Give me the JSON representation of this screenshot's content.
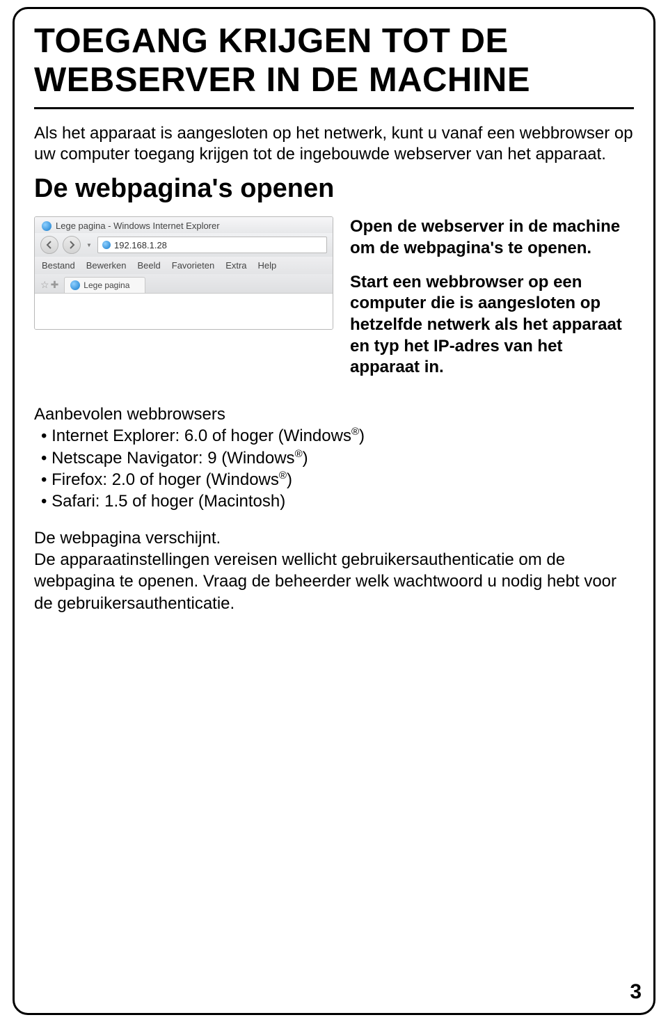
{
  "title": "TOEGANG KRIJGEN TOT DE WEBSERVER IN DE MACHINE",
  "intro": "Als het apparaat is aangesloten op het netwerk, kunt u vanaf een webbrowser op uw computer toegang krijgen tot de ingebouwde webserver van het apparaat.",
  "subhead": "De webpagina's openen",
  "browser": {
    "title": "Lege pagina - Windows Internet Explorer",
    "address": "192.168.1.28",
    "menus": [
      "Bestand",
      "Bewerken",
      "Beeld",
      "Favorieten",
      "Extra",
      "Help"
    ],
    "tab_label": "Lege pagina"
  },
  "instruction1": "Open de webserver in de machine om de webpagina's te openen.",
  "instruction2": "Start een webbrowser op een computer die is aangesloten op hetzelfde netwerk als het apparaat en typ het IP-adres van het apparaat in.",
  "browsers_lead": "Aanbevolen webbrowsers",
  "browsers": {
    "ie": {
      "pre": "Internet Explorer: 6.0 of hoger (Windows",
      "suf": ")"
    },
    "nn": {
      "pre": "Netscape Navigator: 9 (Windows",
      "suf": ")"
    },
    "ff": {
      "pre": "Firefox: 2.0 of hoger (Windows",
      "suf": ")"
    },
    "sf": "Safari: 1.5 of hoger (Macintosh)"
  },
  "reg": "®",
  "footer1": "De webpagina verschijnt.",
  "footer2": "De apparaatinstellingen vereisen wellicht gebruikersauthenticatie om de webpagina te openen. Vraag de beheerder welk wachtwoord u nodig hebt voor de gebruikersauthenticatie.",
  "page_number": "3"
}
